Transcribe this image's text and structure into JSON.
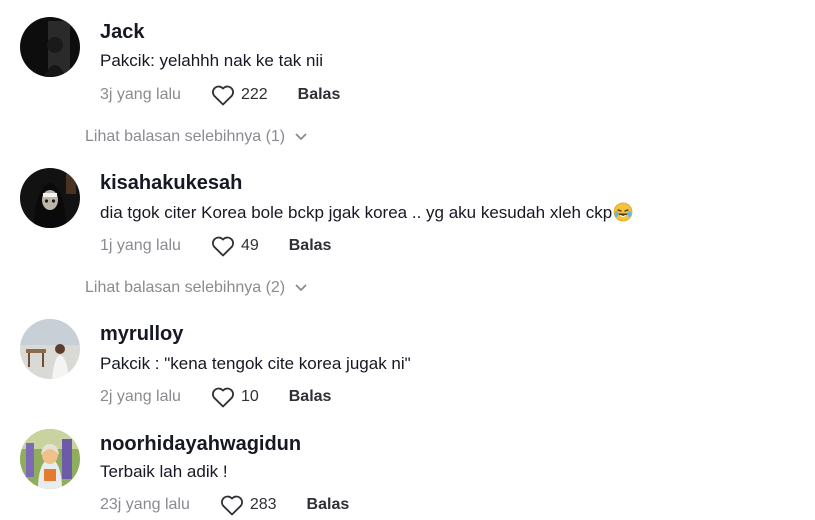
{
  "comments": [
    {
      "username": "Jack",
      "text": "Pakcik: yelahhh nak ke tak nii",
      "time": "3j yang lalu",
      "likes": "222",
      "reply": "Balas",
      "more_replies": "Lihat balasan selebihnya (1)"
    },
    {
      "username": "kisahakukesah",
      "text": "dia tgok citer Korea bole bckp jgak korea .. yg aku kesudah xleh ckp",
      "time": "1j yang lalu",
      "likes": "49",
      "reply": "Balas",
      "more_replies": "Lihat balasan selebihnya (2)"
    },
    {
      "username": "myrulloy",
      "text": "Pakcik : \"kena tengok cite korea jugak ni\"",
      "time": "2j yang lalu",
      "likes": "10",
      "reply": "Balas"
    },
    {
      "username": "noorhidayahwagidun",
      "text": "Terbaik lah adik !",
      "time": "23j yang lalu",
      "likes": "283",
      "reply": "Balas"
    }
  ],
  "icons": {
    "like": "heart-outline-icon",
    "expand": "chevron-down-icon",
    "emoji": "laughing-tears-emoji"
  },
  "colors": {
    "text": "#161823",
    "muted": "#8a8b91",
    "emoji": "#f5c33b"
  }
}
